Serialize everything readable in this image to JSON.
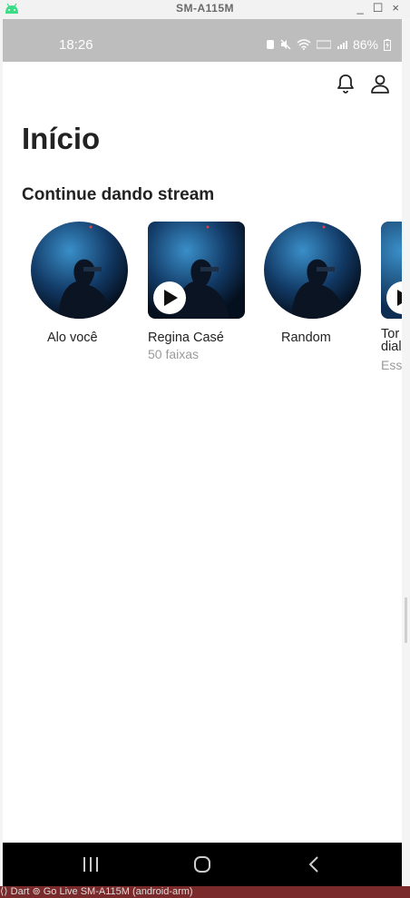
{
  "window": {
    "title": "SM-A115M",
    "minimize": "_",
    "maximize": "☐",
    "close": "×"
  },
  "status_bar": {
    "time": "18:26",
    "battery": "86%"
  },
  "page": {
    "title": "Início",
    "section_title": "Continue dando stream"
  },
  "cards": [
    {
      "name": "Alo você",
      "subtitle": ""
    },
    {
      "name": "Regina Casé",
      "subtitle": "50 faixas"
    },
    {
      "name": "Random",
      "subtitle": ""
    },
    {
      "name": "Tor dial",
      "subtitle": "Ess"
    }
  ],
  "taskbar": {
    "text": "⟨⟩ Dart   ⊚ Go Live   SM-A115M (android-arm)"
  }
}
